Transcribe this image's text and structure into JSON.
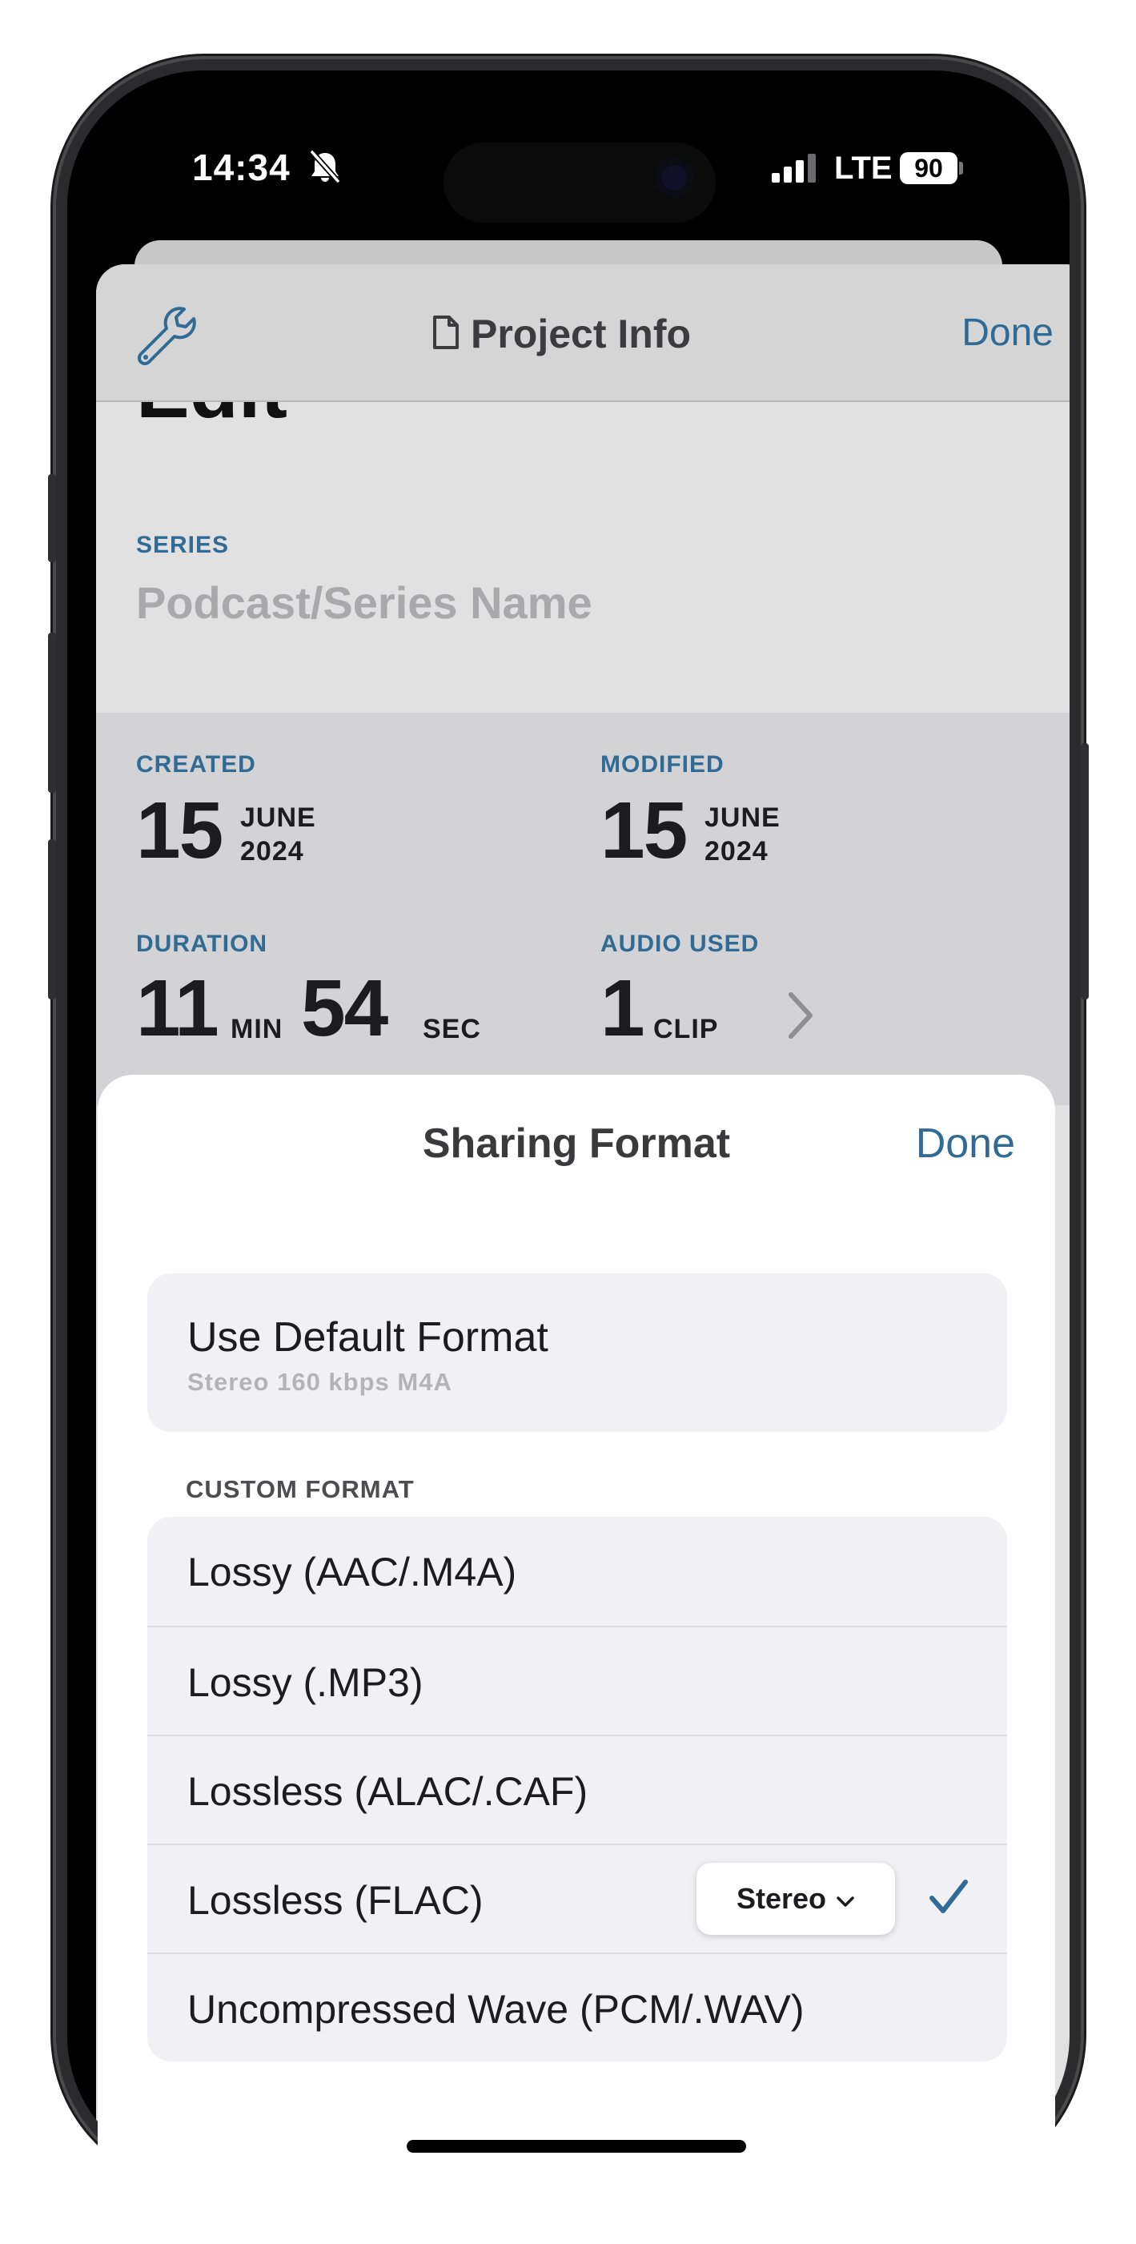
{
  "status_bar": {
    "time": "14:34",
    "network": "LTE",
    "battery": "90"
  },
  "project_info": {
    "title": "Project Info",
    "done_label": "Done",
    "edit_heading": "Edit",
    "series_label": "SERIES",
    "series_placeholder": "Podcast/Series Name",
    "created": {
      "label": "CREATED",
      "day": "15",
      "month": "JUNE",
      "year": "2024"
    },
    "modified": {
      "label": "MODIFIED",
      "day": "15",
      "month": "JUNE",
      "year": "2024"
    },
    "duration": {
      "label": "DURATION",
      "minutes": "11",
      "min_unit": "MIN",
      "seconds": "54",
      "sec_unit": "SEC"
    },
    "audio_used": {
      "label": "AUDIO USED",
      "count": "1",
      "unit": "CLIP"
    }
  },
  "sharing_format": {
    "title": "Sharing Format",
    "done_label": "Done",
    "default_option": {
      "title": "Use Default Format",
      "subtitle": "Stereo 160 kbps M4A"
    },
    "custom_header": "CUSTOM FORMAT",
    "options": [
      {
        "label": "Lossy (AAC/.M4A)"
      },
      {
        "label": "Lossy (.MP3)"
      },
      {
        "label": "Lossless (ALAC/.CAF)"
      },
      {
        "label": "Lossless (FLAC)",
        "channel": "Stereo",
        "selected": true
      },
      {
        "label": "Uncompressed Wave (PCM/.WAV)"
      }
    ]
  },
  "colors": {
    "accent": "#2f6b94",
    "sheet_bg": "#ffffff",
    "group_bg": "#f1f1f5"
  },
  "icons": [
    "bell-slash-icon",
    "signal-icon",
    "battery-icon",
    "wrench-icon",
    "document-icon",
    "chevron-right-icon",
    "chevron-down-icon",
    "checkmark-icon"
  ]
}
